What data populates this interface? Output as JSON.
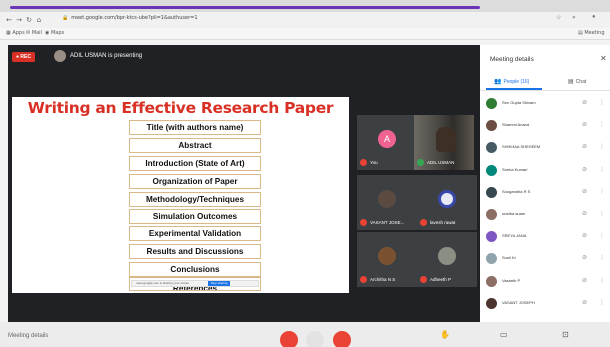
{
  "browser": {
    "url": "meet.google.com/bpr-ktcs-ube?pli=1&authuser=1",
    "bookmarks": [
      "Apps",
      "Mail",
      "Maps"
    ],
    "extra": "Meeting"
  },
  "meet": {
    "rec_label": "REC",
    "presenting_text": "ADIL USMAN is presenting"
  },
  "slide": {
    "title": "Writing an Effective Research Paper",
    "topics": [
      "Title (with authors name)",
      "Abstract",
      "Introduction (State of Art)",
      "Organization of Paper",
      "Methodology/Techniques",
      "Simulation Outcomes",
      "Experimental Validation",
      "Results and Discussions",
      "Conclusions",
      "References"
    ],
    "share_bar_text": "meet.google.com is sharing your screen.",
    "share_bar_button": "Stop sharing"
  },
  "tiles": [
    {
      "name": "You",
      "avatar_letter": "A"
    },
    {
      "name": "ADIL USMAN"
    },
    {
      "name": "VASANT JOSE..."
    },
    {
      "name": "lavesh rawat"
    },
    {
      "name": "Architha N S"
    },
    {
      "name": "Adheeth P"
    }
  ],
  "bottom": {
    "meeting_label": "Meeting details"
  },
  "panel": {
    "title": "Meeting details",
    "tab_people": "People (16)",
    "tab_chat": "Chat",
    "participants": [
      {
        "name": "Sen Gupta Shivam",
        "color": "#2e7d32"
      },
      {
        "name": "Shammi Anand",
        "color": "#6d4c41"
      },
      {
        "name": "SHIKHAA SHEHEEM",
        "color": "#455a64"
      },
      {
        "name": "Sneha Kumari",
        "color": "#00897b"
      },
      {
        "name": "Sougandha R S",
        "color": "#37474f"
      },
      {
        "name": "sradha suam",
        "color": "#8d6e63"
      },
      {
        "name": "SREYA JANA",
        "color": "#7e57c2"
      },
      {
        "name": "Sunil Kr",
        "color": "#90a4ae"
      },
      {
        "name": "Vasanth P",
        "color": "#8d6e63"
      },
      {
        "name": "VASANT JOSEPH",
        "color": "#4e342e"
      }
    ]
  }
}
